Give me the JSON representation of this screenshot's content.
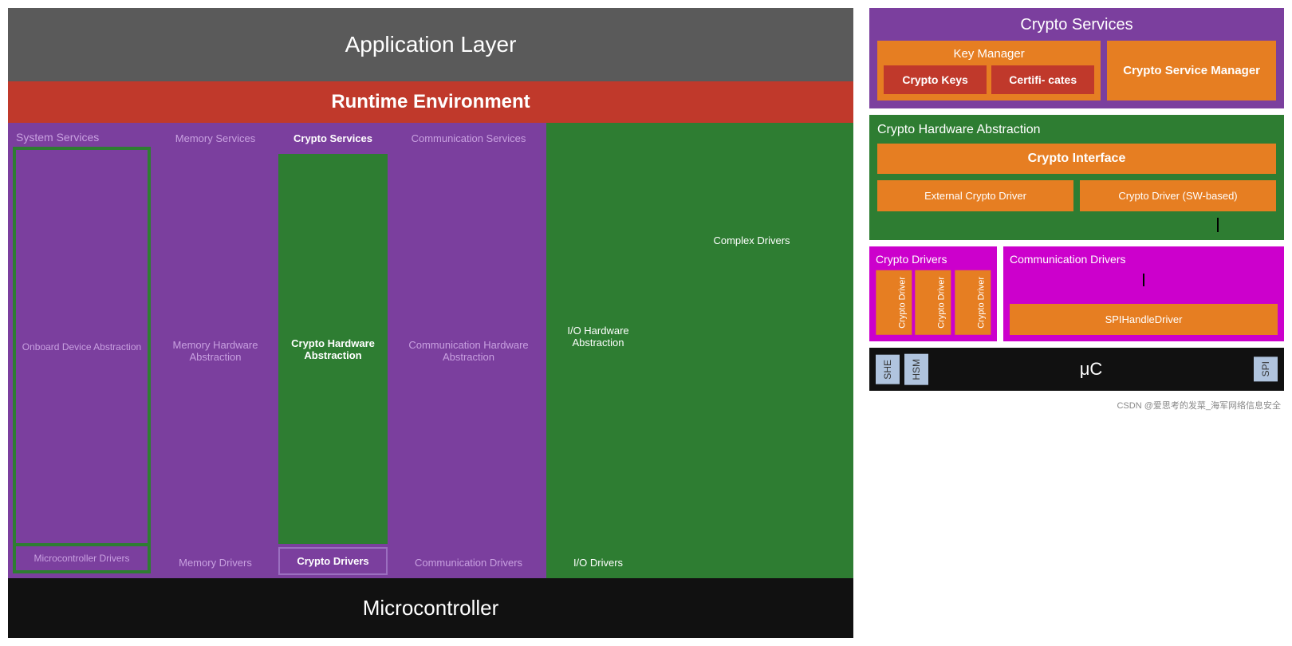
{
  "left": {
    "appLayer": "Application Layer",
    "runtimeEnv": "Runtime Environment",
    "systemServices": "System Services",
    "onboardDevice": "Onboard Device Abstraction",
    "microcontrollerDrivers": "Microcontroller Drivers",
    "memoryServices": "Memory Services",
    "memoryHwAbs": "Memory Hardware Abstraction",
    "memoryDrivers": "Memory Drivers",
    "cryptoServices": "Crypto Services",
    "cryptoHwAbs": "Crypto Hardware Abstraction",
    "cryptoDrivers": "Crypto Drivers",
    "commServices": "Communication Services",
    "commHwAbs": "Communication Hardware Abstraction",
    "commDrivers": "Communication Drivers",
    "ioHwAbs": "I/O Hardware Abstraction",
    "ioDrivers": "I/O Drivers",
    "complexDrivers": "Complex Drivers",
    "microcontroller": "Microcontroller"
  },
  "right": {
    "cryptoServices": "Crypto Services",
    "keyManager": "Key Manager",
    "cryptoKeys": "Crypto Keys",
    "certificates": "Certifi- cates",
    "cryptoServiceManager": "Crypto Service Manager",
    "cryptoHwAbstraction": "Crypto Hardware Abstraction",
    "cryptoInterface": "Crypto Interface",
    "externalCryptoDriver": "External Crypto Driver",
    "cryptoDriverSW": "Crypto Driver (SW-based)",
    "cryptoDriversSection": "Crypto Drivers",
    "cryptoDriver1": "Crypto Driver",
    "cryptoDriver2": "Crypto Driver",
    "cryptoDriver3": "Crypto Driver",
    "commDriversSection": "Communication Drivers",
    "spiHandleDriver": "SPIHandleDriver",
    "mc": {
      "she": "SHE",
      "hsm": "HSM",
      "uC": "μC",
      "spi": "SPI"
    },
    "watermark": "CSDN @爱思考的发菜_海军网络信息安全"
  }
}
